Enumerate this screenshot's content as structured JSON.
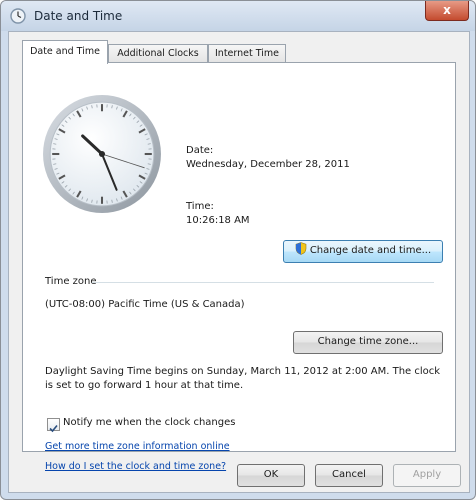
{
  "window": {
    "title": "Date and Time",
    "close_glyph": "x"
  },
  "tabs": [
    {
      "label": "Date and Time",
      "active": true
    },
    {
      "label": "Additional Clocks",
      "active": false
    },
    {
      "label": "Internet Time",
      "active": false
    }
  ],
  "datetime": {
    "date_label": "Date:",
    "date_value": "Wednesday, December 28, 2011",
    "time_label": "Time:",
    "time_value": "10:26:18 AM",
    "change_button": "Change date and time..."
  },
  "clock": {
    "hours": 10,
    "minutes": 26,
    "seconds": 18
  },
  "timezone": {
    "group_label": "Time zone",
    "value": "(UTC-08:00) Pacific Time (US & Canada)",
    "change_button": "Change time zone..."
  },
  "dst": {
    "note": "Daylight Saving Time begins on Sunday, March 11, 2012 at 2:00 AM. The clock is set to go forward 1 hour at that time."
  },
  "notify": {
    "label": "Notify me when the clock changes",
    "checked": true
  },
  "links": {
    "more_info": "Get more time zone information online",
    "how_set": "How do I set the clock and time zone?"
  },
  "footer": {
    "ok": "OK",
    "cancel": "Cancel",
    "apply": "Apply"
  }
}
